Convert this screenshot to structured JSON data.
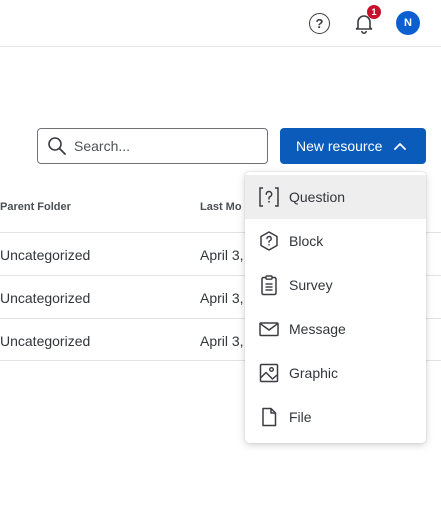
{
  "header": {
    "help_glyph": "?",
    "notifications_count": "1",
    "avatar_initial": "N"
  },
  "toolbar": {
    "search_placeholder": "Search...",
    "new_resource_label": "New resource"
  },
  "table": {
    "columns": [
      "Parent Folder",
      "Last Mo"
    ],
    "rows": [
      {
        "parent_folder": "Uncategorized",
        "last_modified": "April 3,"
      },
      {
        "parent_folder": "Uncategorized",
        "last_modified": "April 3,"
      },
      {
        "parent_folder": "Uncategorized",
        "last_modified": "April 3,"
      }
    ]
  },
  "menu": {
    "items": [
      {
        "label": "Question",
        "icon": "question-icon",
        "active": true
      },
      {
        "label": "Block",
        "icon": "block-icon",
        "active": false
      },
      {
        "label": "Survey",
        "icon": "survey-icon",
        "active": false
      },
      {
        "label": "Message",
        "icon": "message-icon",
        "active": false
      },
      {
        "label": "Graphic",
        "icon": "graphic-icon",
        "active": false
      },
      {
        "label": "File",
        "icon": "file-icon",
        "active": false
      }
    ]
  },
  "colors": {
    "primary": "#0b5cba",
    "badge": "#c8102e",
    "avatar": "#0b5fd0",
    "menu_active": "#eeeeef"
  }
}
